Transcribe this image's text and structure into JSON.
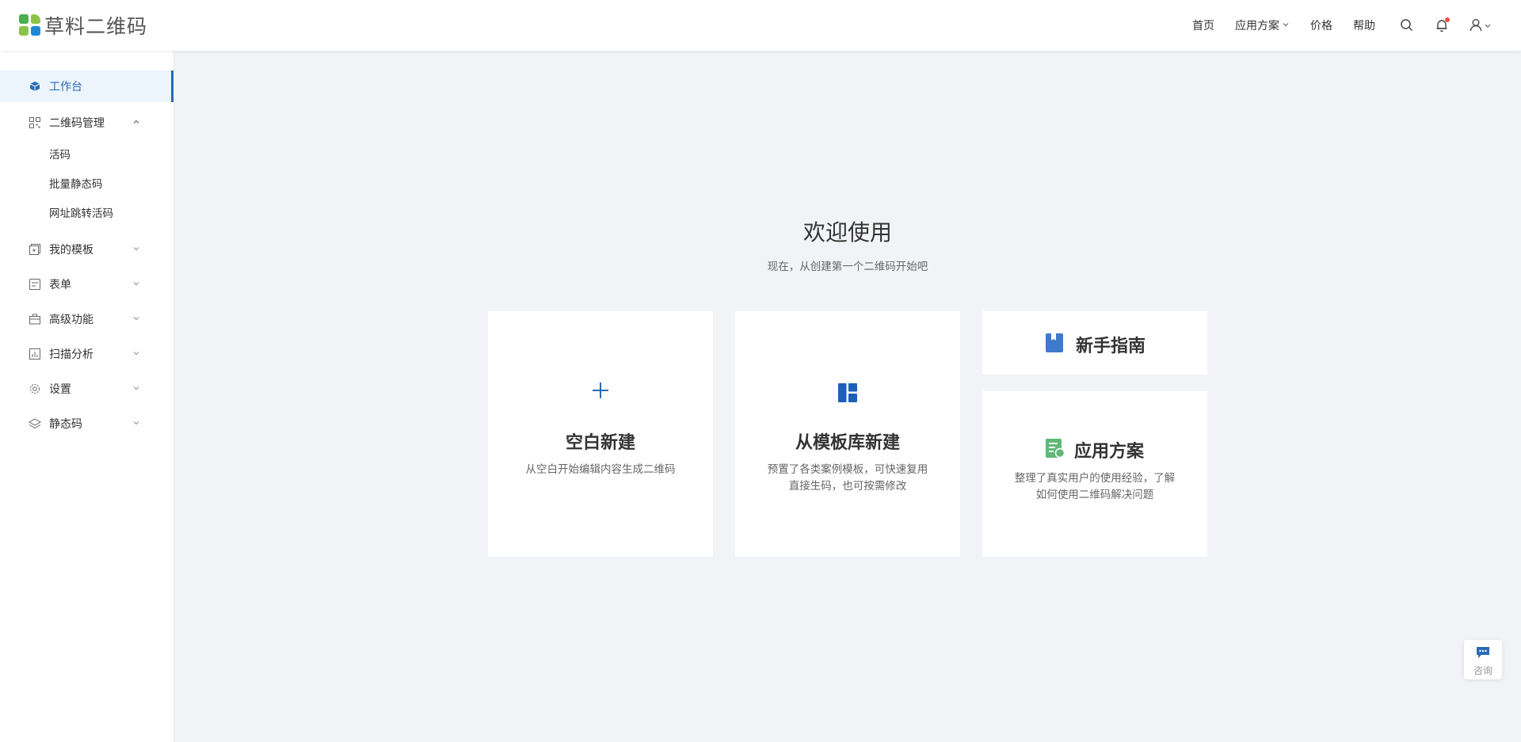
{
  "app": {
    "name": "草料二维码"
  },
  "colors": {
    "accent": "#2a6ab6",
    "logo_green": "#4cae4f",
    "logo_lightgreen": "#8bc34a",
    "logo_blue": "#1f88d4",
    "guide_icon": "#3f79cc",
    "solution_icon": "#5fb878"
  },
  "header": {
    "nav": [
      {
        "label": "首页"
      },
      {
        "label": "应用方案",
        "chevron": "chevron-down-icon"
      },
      {
        "label": "价格"
      },
      {
        "label": "帮助"
      }
    ],
    "icons": [
      "search-icon",
      "bell-icon",
      "user-icon"
    ]
  },
  "sidebar": {
    "items": [
      {
        "label": "工作台",
        "icon": "cube-icon",
        "active": true
      },
      {
        "label": "二维码管理",
        "icon": "qrcode-grid-icon",
        "expanded": true,
        "children": [
          "活码",
          "批量静态码",
          "网址跳转活码"
        ]
      },
      {
        "label": "我的模板",
        "icon": "template-icon"
      },
      {
        "label": "表单",
        "icon": "form-icon"
      },
      {
        "label": "高级功能",
        "icon": "briefcase-icon"
      },
      {
        "label": "扫描分析",
        "icon": "chart-icon"
      },
      {
        "label": "设置",
        "icon": "gear-icon"
      },
      {
        "label": "静态码",
        "icon": "layers-icon"
      }
    ]
  },
  "main": {
    "title": "欢迎使用",
    "subtitle": "现在，从创建第一个二维码开始吧",
    "cards": {
      "blank": {
        "title": "空白新建",
        "desc": "从空白开始编辑内容生成二维码"
      },
      "template": {
        "title": "从模板库新建",
        "desc_line1": "预置了各类案例模板，可快速复用",
        "desc_line2": "直接生码，也可按需修改"
      },
      "guide": {
        "title": "新手指南"
      },
      "solution": {
        "title": "应用方案",
        "desc_line1": "整理了真实用户的使用经验，了解",
        "desc_line2": "如何使用二维码解决问题"
      }
    }
  },
  "consult": {
    "label": "咨询"
  }
}
